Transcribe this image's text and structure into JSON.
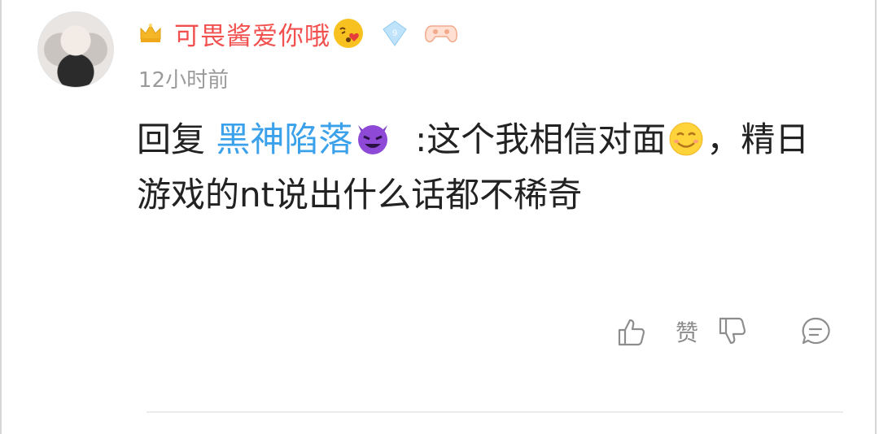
{
  "comment": {
    "username": "可畏酱爱你哦",
    "time": "12小时前",
    "reply_prefix": "回复",
    "reply_target": "黑神陷落",
    "text_part1": ":这个我相信对面",
    "text_part2": "，精日游戏的nt说出什么话都不稀奇",
    "level": "9"
  },
  "actions": {
    "like_label": "赞"
  },
  "colors": {
    "username": "#f2504f",
    "mention": "#3aa1ea",
    "time": "#9b9b9b",
    "icon": "#8d8d8d"
  },
  "icons": [
    "crown-icon",
    "kiss-emoji-icon",
    "level-badge-icon",
    "game-controller-icon",
    "devil-emoji-icon",
    "smile-emoji-icon",
    "thumb-up-icon",
    "thumb-down-icon",
    "comment-icon"
  ]
}
